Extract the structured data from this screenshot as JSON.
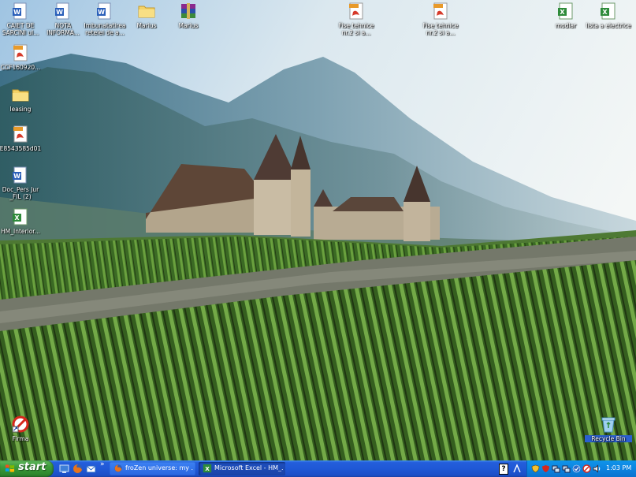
{
  "desktop": {
    "icons": [
      {
        "id": "doc1",
        "label": "CAIET DE SARCINI ul...",
        "type": "word"
      },
      {
        "id": "doc2",
        "label": "NOTA INFORMA...",
        "type": "word"
      },
      {
        "id": "doc3",
        "label": "Imbunatatirea retelei de a...",
        "type": "word"
      },
      {
        "id": "folder1",
        "label": "Marius",
        "type": "folder"
      },
      {
        "id": "rar1",
        "label": "Marius",
        "type": "rar"
      },
      {
        "id": "pdf1",
        "label": "Fise tehnice nr.2 si a...",
        "type": "pdf"
      },
      {
        "id": "pdf2",
        "label": "Fise tehnice nr.2 si a...",
        "type": "pdf"
      },
      {
        "id": "xls1",
        "label": "modlar",
        "type": "excel"
      },
      {
        "id": "xls2",
        "label": "lista a electrice",
        "type": "excel"
      },
      {
        "id": "pdf3",
        "label": "CCF160920...",
        "type": "pdf"
      },
      {
        "id": "folder2",
        "label": "leasing",
        "type": "folder"
      },
      {
        "id": "pdf4",
        "label": "E8543585d01",
        "type": "pdf"
      },
      {
        "id": "doc4",
        "label": "Doc_Pers Jur _FIL (2)",
        "type": "word"
      },
      {
        "id": "xls3",
        "label": "HM_Interior...",
        "type": "excel"
      },
      {
        "id": "firma",
        "label": "Firma",
        "type": "firma"
      },
      {
        "id": "recycle",
        "label": "Recycle Bin",
        "type": "recycle"
      }
    ]
  },
  "taskbar": {
    "start_label": "start",
    "quick_launch": [
      "desktop-icon",
      "firefox-icon",
      "outlook-icon"
    ],
    "more_glyph": "»",
    "buttons": [
      {
        "label": "froZen universe: my ...",
        "icon": "firefox-icon"
      },
      {
        "label": "Microsoft Excel - HM_...",
        "icon": "excel-icon"
      }
    ],
    "help_glyph": "?",
    "clock": "1:03 PM"
  },
  "colors": {
    "taskbar": "#245edb",
    "start": "#3c9a3a",
    "tray": "#0c84e0"
  }
}
